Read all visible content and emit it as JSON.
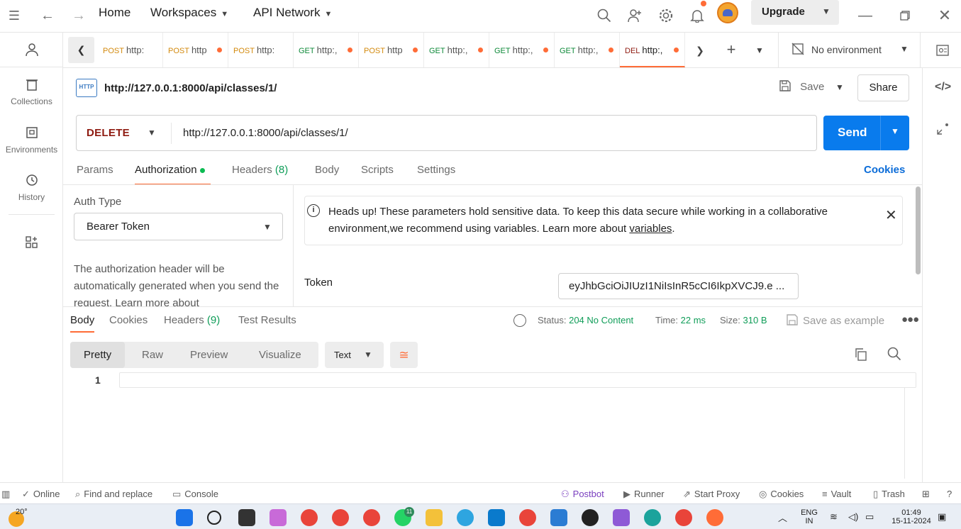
{
  "topbar": {
    "home": "Home",
    "workspaces": "Workspaces",
    "api_network": "API Network",
    "upgrade": "Upgrade"
  },
  "sidebar": {
    "items": [
      {
        "label": "Collections",
        "icon": "trash-can-icon"
      },
      {
        "label": "Environments",
        "icon": "environment-icon"
      },
      {
        "label": "History",
        "icon": "history-icon"
      }
    ]
  },
  "tabs": [
    {
      "method": "POST",
      "url": "http:",
      "dirty": false
    },
    {
      "method": "POST",
      "url": "http",
      "dirty": true
    },
    {
      "method": "POST",
      "url": "http:",
      "dirty": false
    },
    {
      "method": "GET",
      "url": "http:,",
      "dirty": true
    },
    {
      "method": "POST",
      "url": "http",
      "dirty": true
    },
    {
      "method": "GET",
      "url": "http:,",
      "dirty": true
    },
    {
      "method": "GET",
      "url": "http:,",
      "dirty": true
    },
    {
      "method": "GET",
      "url": "http:,",
      "dirty": true
    },
    {
      "method": "DEL",
      "url": "http:,",
      "dirty": true,
      "active": true
    }
  ],
  "environment": "No environment",
  "request": {
    "title": "http://127.0.0.1:8000/api/classes/1/",
    "method": "DELETE",
    "url": "http://127.0.0.1:8000/api/classes/1/",
    "save_label": "Save",
    "share_label": "Share",
    "send_label": "Send",
    "badge": "HTTP"
  },
  "request_tabs": {
    "params": "Params",
    "authorization": "Authorization",
    "headers": "Headers",
    "headers_count": "(8)",
    "body": "Body",
    "scripts": "Scripts",
    "settings": "Settings",
    "cookies": "Cookies"
  },
  "auth": {
    "type_label": "Auth Type",
    "type_value": "Bearer Token",
    "description": "The authorization header will be automatically generated when you send the request. Learn more about",
    "alert_text": "Heads up! These parameters hold sensitive data. To keep this data secure while working in a collaborative environment,we recommend using variables. Learn more about ",
    "alert_link": "variables",
    "alert_end": ".",
    "token_label": "Token",
    "token_value": "eyJhbGciOiJIUzI1NiIsInR5cCI6IkpXVCJ9.e ..."
  },
  "response": {
    "tabs": {
      "body": "Body",
      "cookies": "Cookies",
      "headers": "Headers",
      "headers_count": "(9)",
      "test_results": "Test Results"
    },
    "status_label": "Status:",
    "status_value": "204 No Content",
    "time_label": "Time:",
    "time_value": "22 ms",
    "size_label": "Size:",
    "size_value": "310 B",
    "save_example": "Save as example",
    "views": [
      "Pretty",
      "Raw",
      "Preview",
      "Visualize"
    ],
    "format": "Text",
    "line_number": "1"
  },
  "statusbar": {
    "online": "Online",
    "find_replace": "Find and replace",
    "console": "Console",
    "postbot": "Postbot",
    "runner": "Runner",
    "start_proxy": "Start Proxy",
    "cookies": "Cookies",
    "vault": "Vault",
    "trash": "Trash"
  },
  "taskbar": {
    "weather": "20°",
    "lang_1": "ENG",
    "lang_2": "IN",
    "time": "01:49",
    "date": "15-11-2024",
    "whatsapp_badge": "11"
  },
  "colors": {
    "accent": "#ff6c37",
    "send": "#097bed",
    "delete_method": "#8e1a10",
    "success": "#0f9d58"
  }
}
